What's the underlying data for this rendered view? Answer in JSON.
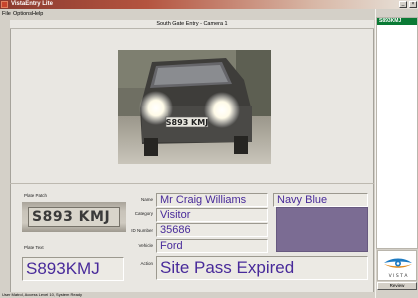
{
  "window": {
    "title": "VistaEntry Lite",
    "minimize": "_",
    "close": "×"
  },
  "menu": [
    "File",
    "Options",
    "Help"
  ],
  "camera": {
    "title": "South Gate Entry - Camera 1",
    "plate_reading": "S893 KMJ"
  },
  "plate_patch": {
    "label": "Plate Patch",
    "plate": "S893 KMJ"
  },
  "plate_text": {
    "label": "Plate Text",
    "value": "S893KMJ"
  },
  "details": {
    "name": {
      "label": "Name",
      "value": "Mr Craig Williams"
    },
    "category": {
      "label": "Category",
      "value": "Visitor"
    },
    "id_number": {
      "label": "ID Number",
      "value": "35686"
    },
    "vehicle": {
      "label": "Vehicle",
      "value": "Ford"
    },
    "action": {
      "label": "Action",
      "value": "Site Pass Expired"
    },
    "colour": {
      "value": "Navy Blue",
      "swatch": "#7b6c93"
    }
  },
  "sidebar": {
    "plates": [
      "S893KMJ"
    ],
    "logo_text": "V I S T A",
    "review_label": "Review"
  },
  "status": "User Matrol, Access Level 10, System Ready",
  "colors": {
    "text_accent": "#482a9a",
    "selected_row": "#0a7a35",
    "titlebar": "#8a3a2f"
  }
}
